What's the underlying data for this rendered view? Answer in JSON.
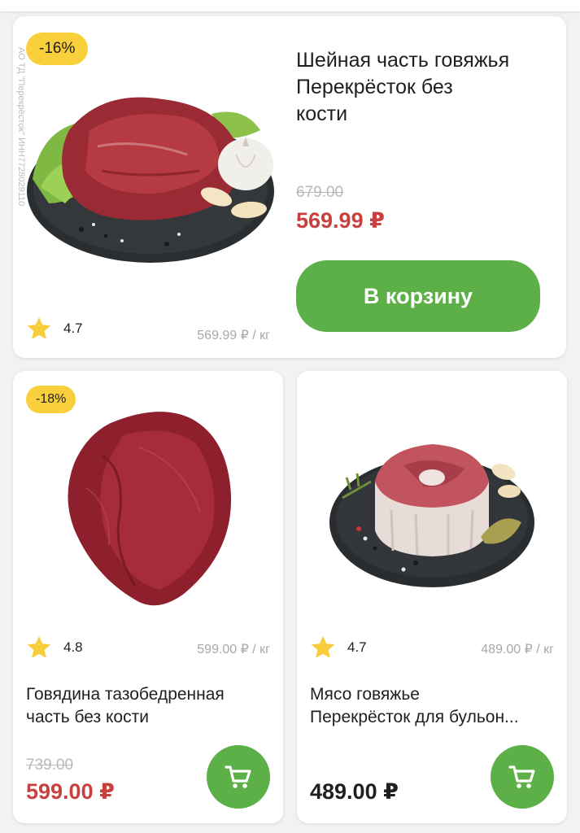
{
  "products": [
    {
      "discount": "-16%",
      "title_lines": [
        "Шейная часть говяжья",
        "Перекрёсток без",
        "кости"
      ],
      "old_price": "679.00",
      "price": "569.99 ₽",
      "rating": "4.7",
      "unit_price": "569.99 ₽ / кг",
      "cta": "В корзину",
      "legal": "АО ТД \"Перекрёсток\" ИНН7728029110"
    },
    {
      "discount": "-18%",
      "title_lines": [
        "Говядина тазобедренная",
        "часть без кости"
      ],
      "old_price": "739.00",
      "price": "599.00 ₽",
      "rating": "4.8",
      "unit_price": "599.00 ₽ / кг"
    },
    {
      "title_lines": [
        "Мясо говяжье",
        "Перекрёсток для бульон..."
      ],
      "price": "489.00 ₽",
      "rating": "4.7",
      "unit_price": "489.00 ₽ / кг"
    }
  ],
  "icons": {
    "star": "star-icon",
    "cart": "cart-icon"
  },
  "colors": {
    "accent_green": "#5cb047",
    "badge_yellow": "#f9cf3b",
    "sale_red": "#c64140",
    "star_yellow": "#f7cd3b"
  }
}
